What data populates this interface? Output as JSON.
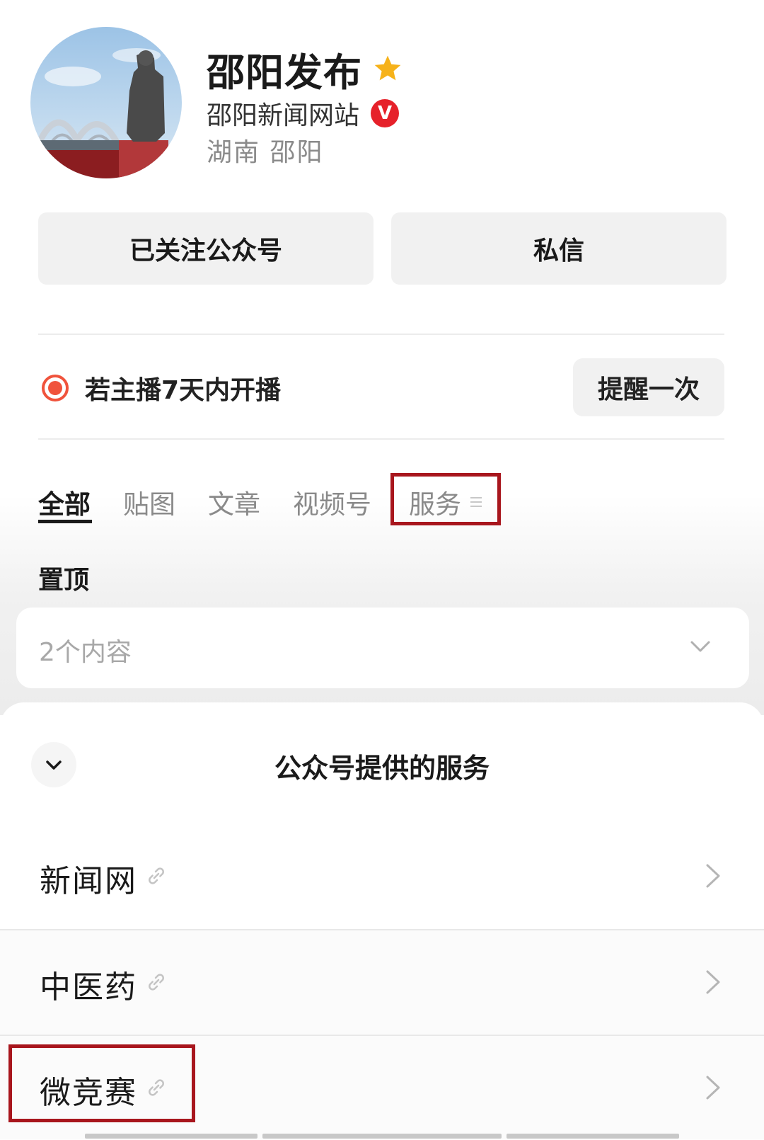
{
  "profile": {
    "name": "邵阳发布",
    "organization": "邵阳新闻网站",
    "verified_badge": "V",
    "location": "湖南 邵阳",
    "star_color": "#f6b21a",
    "verified_color": "#e6212a"
  },
  "actions": {
    "follow_label": "已关注公众号",
    "message_label": "私信"
  },
  "live": {
    "text": "若主播7天内开播",
    "remind_label": "提醒一次",
    "icon_color": "#f0533c"
  },
  "tabs": [
    {
      "label": "全部",
      "active": true
    },
    {
      "label": "贴图",
      "active": false
    },
    {
      "label": "文章",
      "active": false
    },
    {
      "label": "视频号",
      "active": false
    },
    {
      "label": "服务",
      "active": false
    }
  ],
  "pinned": {
    "label": "置顶",
    "summary": "2个内容"
  },
  "services_sheet": {
    "title": "公众号提供的服务",
    "items": [
      {
        "label": "新闻网",
        "icon": "link-icon"
      },
      {
        "label": "中医药",
        "icon": "link-icon"
      },
      {
        "label": "微竞赛",
        "icon": "link-icon"
      }
    ]
  },
  "highlight_color": "#a8161d"
}
